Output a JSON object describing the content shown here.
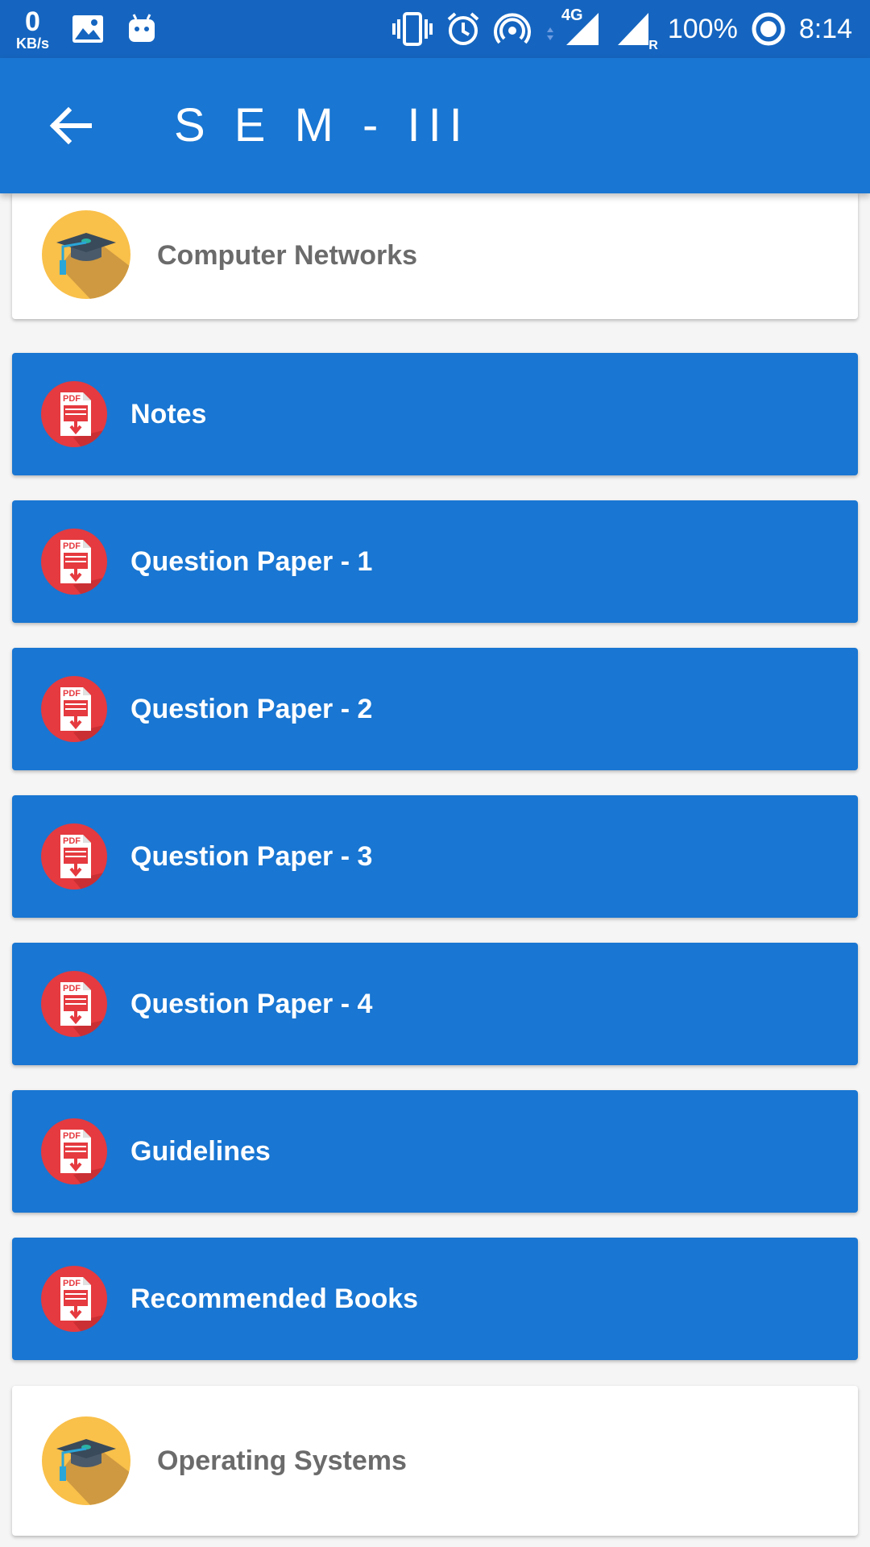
{
  "status_bar": {
    "net_speed_value": "0",
    "net_speed_unit": "KB/s",
    "network_type": "4G",
    "roaming_indicator": "R",
    "battery": "100%",
    "time": "8:14"
  },
  "app_bar": {
    "title": "S E M - III"
  },
  "subjects": [
    {
      "name": "Computer Networks",
      "items": [
        {
          "label": "Notes"
        },
        {
          "label": "Question Paper - 1"
        },
        {
          "label": "Question Paper - 2"
        },
        {
          "label": "Question Paper - 3"
        },
        {
          "label": "Question Paper - 4"
        },
        {
          "label": "Guidelines"
        },
        {
          "label": "Recommended Books"
        }
      ]
    },
    {
      "name": "Operating Systems"
    }
  ],
  "icons": {
    "subject": "graduation-cap-icon",
    "document": "pdf-download-icon"
  },
  "colors": {
    "status_bar": "#1565c0",
    "primary": "#1976d2",
    "pdf_red": "#e53a3f",
    "cap_yellow": "#f9c04a",
    "subject_text": "#6b6b6b"
  },
  "pdf_badge_text": "PDF"
}
